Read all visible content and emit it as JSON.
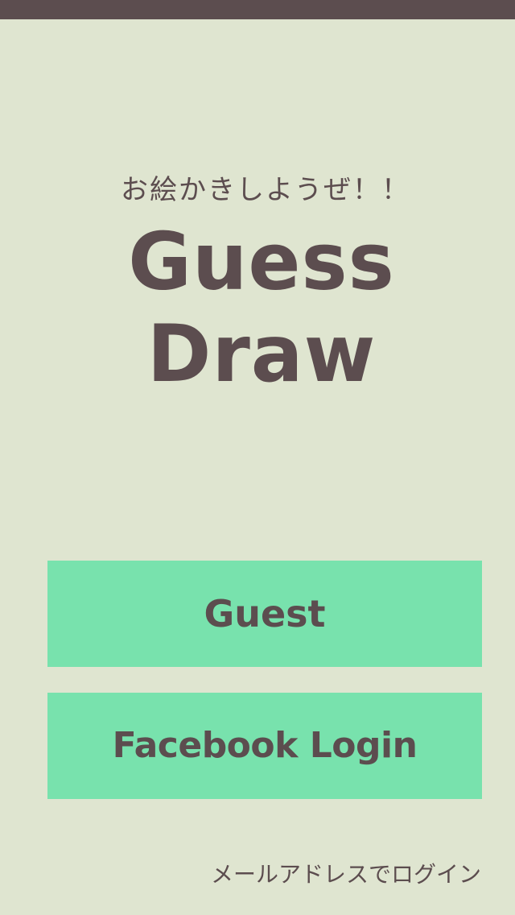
{
  "colors": {
    "background": "#dfe5d0",
    "status_bar": "#5c4d4f",
    "button": "#78e2ad",
    "text": "#5c4d4f"
  },
  "header": {
    "tagline": "お絵かきしようぜ！！",
    "title": "Guess Draw"
  },
  "buttons": {
    "guest_label": "Guest",
    "facebook_label": "Facebook Login"
  },
  "footer": {
    "email_login_label": "メールアドレスでログイン"
  }
}
